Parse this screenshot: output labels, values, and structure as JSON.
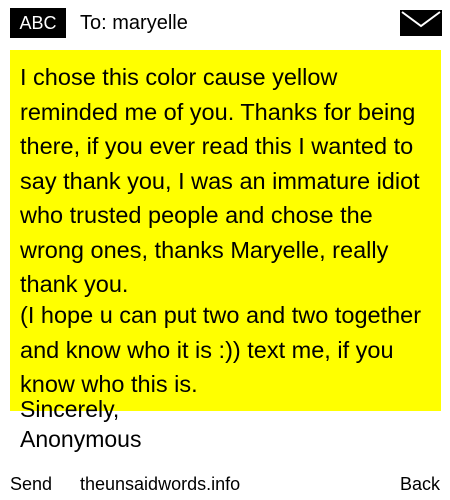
{
  "header": {
    "mode_badge": "ABC",
    "to_label": "To:",
    "recipient": "maryelle",
    "envelope_icon": "envelope-icon"
  },
  "message": {
    "background_color": "#ffff00",
    "paragraph_1": "I chose this color cause yellow reminded me of you. Thanks for being there, if you ever read this I wanted to say thank you, I was an immature idiot who trusted people and chose the wrong ones, thanks Maryelle, really thank you.",
    "paragraph_2": "(I hope u can put two and two together and know who it is :)) text me, if you know who this is.",
    "signoff": "Sincerely,",
    "signature": "Anonymous"
  },
  "footer": {
    "send_label": "Send",
    "site_label": "theunsaidwords.info",
    "back_label": "Back"
  }
}
